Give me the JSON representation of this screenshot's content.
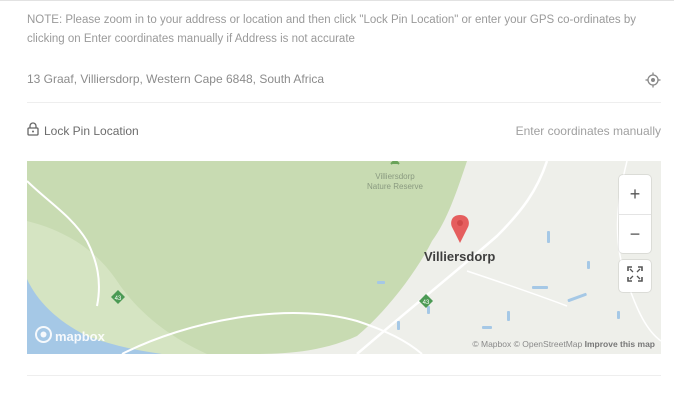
{
  "note": "NOTE: Please zoom in to your address or location and then click \"Lock Pin Location\" or enter your GPS co-ordinates by clicking on Enter coordinates manually if Address is not accurate",
  "address": "13 Graaf, Villiersdorp, Western Cape 6848, South Africa",
  "lock_label": "Lock Pin Location",
  "manual_label": "Enter coordinates manually",
  "map": {
    "place_label": "Villiersdorp",
    "reserve_label_1": "Villiersdorp",
    "reserve_label_2": "Nature Reserve",
    "road_badge": "43",
    "zoom_in": "+",
    "zoom_out": "−",
    "logo_text": "mapbox",
    "attribution": "© Mapbox © OpenStreetMap",
    "improve_link": "Improve this map"
  },
  "colors": {
    "pin": "#e55e5e",
    "forest": "#c9dcb3",
    "water": "#a5c8e6",
    "road_badge": "#4b9a54"
  },
  "icons": [
    "lock-icon",
    "locate-icon",
    "map-pin-icon",
    "fullscreen-icon",
    "mapbox-logo-icon"
  ]
}
